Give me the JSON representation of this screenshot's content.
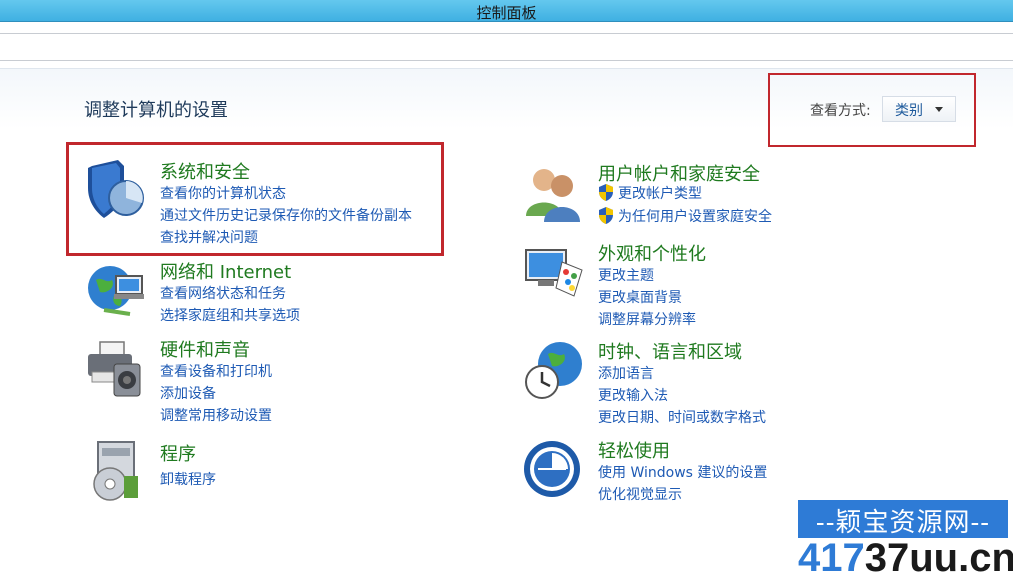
{
  "window": {
    "title": "控制面板"
  },
  "page": {
    "title": "调整计算机的设置"
  },
  "view_by": {
    "label": "查看方式:",
    "value": "类别"
  },
  "categories": [
    {
      "heading": "系统和安全",
      "icon": "shield-pie-icon",
      "links": [
        "查看你的计算机状态",
        "通过文件历史记录保存你的文件备份副本",
        "查找并解决问题"
      ]
    },
    {
      "heading": "网络和 Internet",
      "icon": "network-globe-icon",
      "links": [
        "查看网络状态和任务",
        "选择家庭组和共享选项"
      ]
    },
    {
      "heading": "硬件和声音",
      "icon": "printer-speaker-icon",
      "links": [
        "查看设备和打印机",
        "添加设备",
        "调整常用移动设置"
      ]
    },
    {
      "heading": "程序",
      "icon": "programs-disc-icon",
      "links": [
        "卸载程序"
      ]
    },
    {
      "heading": "用户帐户和家庭安全",
      "icon": "users-icon",
      "links": [
        "更改帐户类型",
        "为任何用户设置家庭安全"
      ]
    },
    {
      "heading": "外观和个性化",
      "icon": "monitor-palette-icon",
      "links": [
        "更改主题",
        "更改桌面背景",
        "调整屏幕分辨率"
      ]
    },
    {
      "heading": "时钟、语言和区域",
      "icon": "clock-globe-icon",
      "links": [
        "添加语言",
        "更改输入法",
        "更改日期、时间或数字格式"
      ]
    },
    {
      "heading": "轻松使用",
      "icon": "ease-of-access-icon",
      "links": [
        "使用 Windows 建议的设置",
        "优化视觉显示"
      ]
    }
  ],
  "watermark": {
    "top": "--颖宝资源网--",
    "num": "417",
    "site": "37uu.cn"
  },
  "colors": {
    "heading": "#1f7a1f",
    "link": "#1e5ab4",
    "highlight": "#c1272d",
    "titlebar": "#4fbbe8"
  }
}
